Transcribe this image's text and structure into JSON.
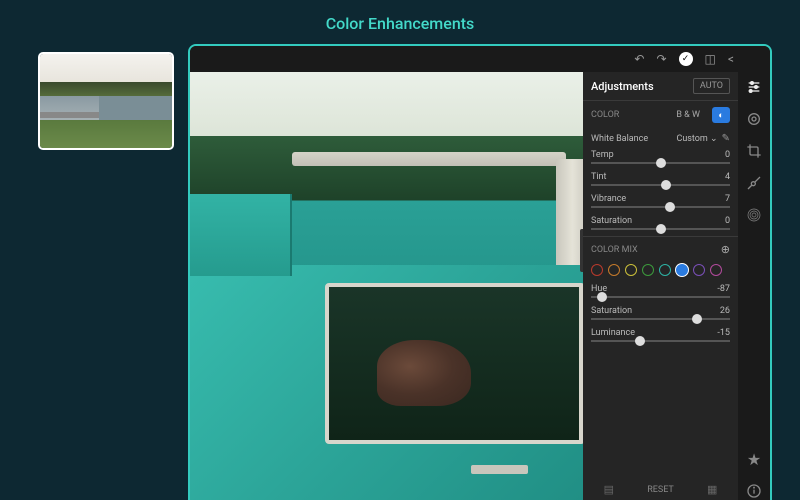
{
  "header": {
    "title": "Color Enhancements"
  },
  "panel": {
    "title": "Adjustments",
    "auto_label": "AUTO",
    "mode": {
      "label": "COLOR",
      "bw_label": "B & W"
    },
    "white_balance": {
      "label": "White Balance",
      "value": "Custom"
    },
    "sliders": {
      "temp": {
        "label": "Temp",
        "value": "0",
        "pos": 50
      },
      "tint": {
        "label": "Tint",
        "value": "4",
        "pos": 54
      },
      "vibrance": {
        "label": "Vibrance",
        "value": "7",
        "pos": 57
      },
      "saturation": {
        "label": "Saturation",
        "value": "0",
        "pos": 50
      }
    },
    "color_mix": {
      "label": "COLOR MIX",
      "swatches": [
        "#b93a2c",
        "#c57a2b",
        "#cabf3a",
        "#3c9a3c",
        "#2db3a5",
        "#2a7be0",
        "#7a4fb8",
        "#b24a9c"
      ],
      "selected_index": 5,
      "hue": {
        "label": "Hue",
        "value": "-87",
        "pos": 8
      },
      "saturation": {
        "label": "Saturation",
        "value": "26",
        "pos": 76
      },
      "luminance": {
        "label": "Luminance",
        "value": "-15",
        "pos": 35
      }
    },
    "reset_label": "RESET"
  }
}
